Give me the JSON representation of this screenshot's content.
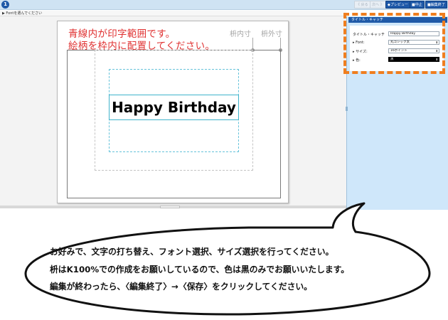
{
  "toolbar": {
    "logo": "1",
    "back_label": "《 戻る",
    "next_label": "次へ 》",
    "preview_label": "◆プレビュー",
    "stop_label": "■中止",
    "finish_label": "■編集終了"
  },
  "subbar": {
    "text": "▶ Fontを選んでください"
  },
  "canvas": {
    "note_line1": "青線内が印字範囲です。",
    "note_line2": "絵柄を枠内に配置してください。",
    "inner_dim_label": "枡内寸",
    "outer_dim_label": "枡外寸",
    "text_value": "Happy Birthday"
  },
  "panel": {
    "title": "タイトル・キャッチ",
    "title_label": "タイトル・キャッチ",
    "title_value": "Happy Birthday",
    "font_label": "▸ Font:",
    "font_value": "丸ゴシック太",
    "size_label": "▸ サイズ:",
    "size_value": "16ポイント",
    "color_label": "▸ 色:",
    "color_value": "黒"
  },
  "colors": {
    "accent": "#1f5aa8",
    "highlight": "#ef7e1f",
    "note_red": "#e03232",
    "print_area_blue": "#66c3da"
  },
  "instructions": {
    "line1": "お好みで、文字の打ち替え、フォント選択、サイズ選択を行ってください。",
    "line2": "枡はK100%での作成をお願いしているので、色は黒のみでお願いいたします。",
    "line3": "編集が終わったら、〈編集終了〉→〈保存〉をクリックしてください。"
  }
}
